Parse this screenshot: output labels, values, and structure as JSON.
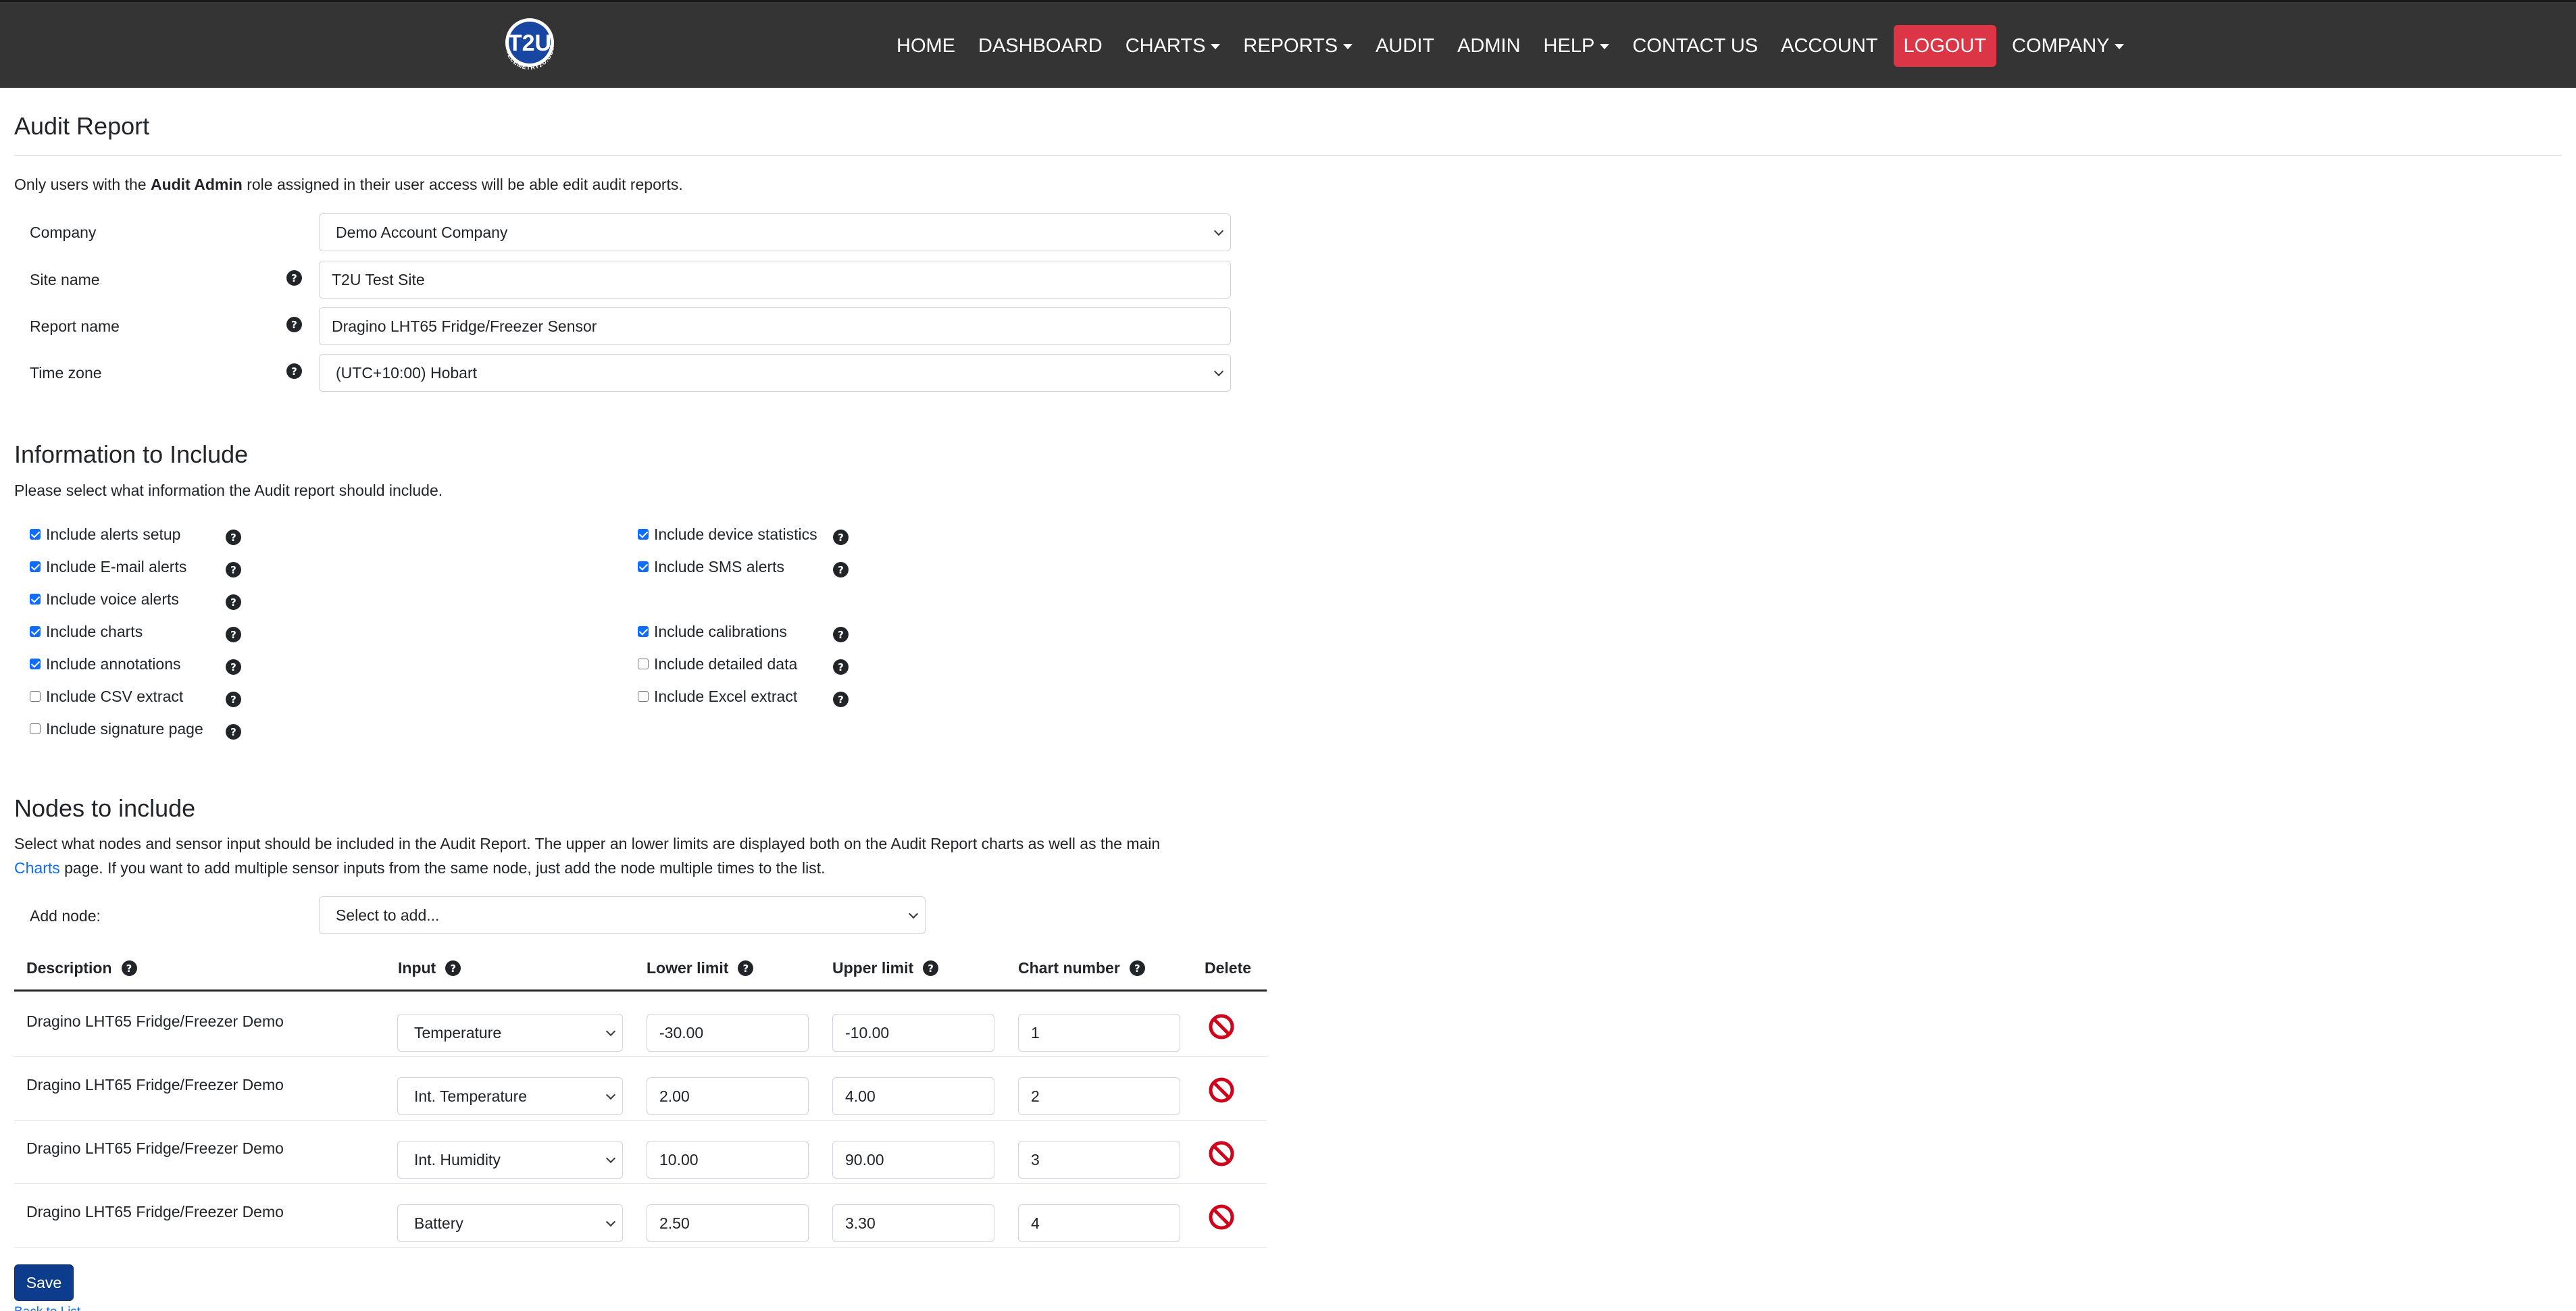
{
  "brand": {
    "logo_text": "T2U",
    "logo_ring_text": "TELEMETRY2U.COM"
  },
  "nav": {
    "items": [
      {
        "label": "HOME",
        "dropdown": false
      },
      {
        "label": "DASHBOARD",
        "dropdown": false
      },
      {
        "label": "CHARTS",
        "dropdown": true
      },
      {
        "label": "REPORTS",
        "dropdown": true
      },
      {
        "label": "AUDIT",
        "dropdown": false
      },
      {
        "label": "ADMIN",
        "dropdown": false
      },
      {
        "label": "HELP",
        "dropdown": true
      },
      {
        "label": "CONTACT US",
        "dropdown": false
      },
      {
        "label": "ACCOUNT",
        "dropdown": false
      },
      {
        "label": "LOGOUT",
        "dropdown": false
      },
      {
        "label": "COMPANY",
        "dropdown": true
      }
    ]
  },
  "page": {
    "title": "Audit Report",
    "note_pre": "Only users with the ",
    "note_bold": "Audit Admin",
    "note_post": " role assigned in their user access will be able edit audit reports."
  },
  "form": {
    "company": {
      "label": "Company",
      "value": "Demo Account Company"
    },
    "site_name": {
      "label": "Site name",
      "value": "T2U Test Site"
    },
    "report_name": {
      "label": "Report name",
      "value": "Dragino LHT65 Fridge/Freezer Sensor"
    },
    "time_zone": {
      "label": "Time zone",
      "value": "(UTC+10:00) Hobart"
    }
  },
  "info": {
    "title": "Information to Include",
    "desc": "Please select what information the Audit report should include.",
    "left": [
      {
        "label": "Include alerts setup",
        "checked": true
      },
      {
        "label": "Include E-mail alerts",
        "checked": true
      },
      {
        "label": "Include voice alerts",
        "checked": true
      },
      {
        "label": "Include charts",
        "checked": true
      },
      {
        "label": "Include annotations",
        "checked": true
      },
      {
        "label": "Include CSV extract",
        "checked": false
      },
      {
        "label": "Include signature page",
        "checked": false
      }
    ],
    "right": [
      {
        "label": "Include device statistics",
        "checked": true
      },
      {
        "label": "Include SMS alerts",
        "checked": true
      },
      {
        "label": "Include calibrations",
        "checked": true
      },
      {
        "label": "Include detailed data",
        "checked": false
      },
      {
        "label": "Include Excel extract",
        "checked": false
      }
    ]
  },
  "nodes": {
    "title": "Nodes to include",
    "desc_1": "Select what nodes and sensor input should be included in the Audit Report. The upper an lower limits are displayed both on the Audit Report charts as well as the main",
    "desc_link": "Charts",
    "desc_2": " page. If you want to add multiple sensor inputs from the same node, just add the node multiple times to the list.",
    "add_label": "Add node:",
    "add_placeholder": "Select to add...",
    "headers": {
      "description": "Description",
      "input": "Input",
      "lower": "Lower limit",
      "upper": "Upper limit",
      "chart": "Chart number",
      "delete": "Delete"
    },
    "rows": [
      {
        "description": "Dragino LHT65 Fridge/Freezer Demo",
        "input": "Temperature",
        "lower": "-30.00",
        "upper": "-10.00",
        "chart": "1"
      },
      {
        "description": "Dragino LHT65 Fridge/Freezer Demo",
        "input": "Int. Temperature",
        "lower": "2.00",
        "upper": "4.00",
        "chart": "2"
      },
      {
        "description": "Dragino LHT65 Fridge/Freezer Demo",
        "input": "Int. Humidity",
        "lower": "10.00",
        "upper": "90.00",
        "chart": "3"
      },
      {
        "description": "Dragino LHT65 Fridge/Freezer Demo",
        "input": "Battery",
        "lower": "2.50",
        "upper": "3.30",
        "chart": "4"
      }
    ],
    "save_label": "Save",
    "back_label": "Back to List"
  },
  "colors": {
    "navbar": "#343434",
    "logout": "#dc3545",
    "primary": "#0d3c8c",
    "link": "#0d6efd",
    "delete": "#d0021b"
  }
}
